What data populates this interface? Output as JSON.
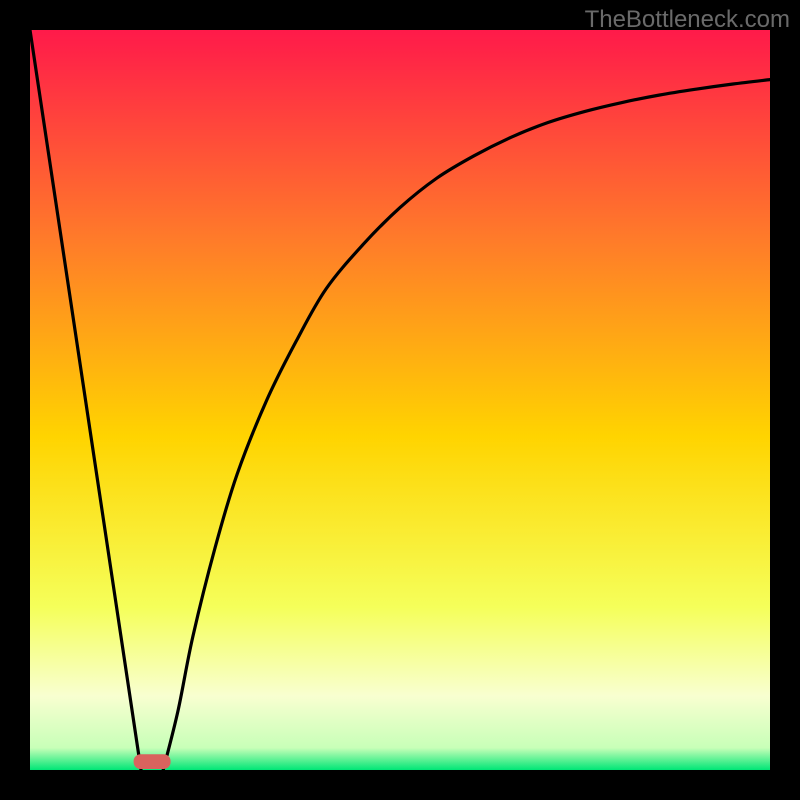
{
  "watermark": "TheBottleneck.com",
  "chart_data": {
    "type": "line",
    "title": "",
    "xlabel": "",
    "ylabel": "",
    "xlim": [
      0,
      100
    ],
    "ylim": [
      0,
      100
    ],
    "grid": false,
    "gradient_colors": {
      "top": "#ff1a4a",
      "upper_mid": "#ff7a2a",
      "mid": "#ffd400",
      "lower_mid": "#f5ff5a",
      "band": "#f8ffd0",
      "bottom": "#00e676"
    },
    "series": [
      {
        "name": "left-descending-line",
        "x": [
          0,
          15
        ],
        "y": [
          100,
          0
        ]
      },
      {
        "name": "right-ascending-curve",
        "x": [
          18,
          20,
          22,
          25,
          28,
          32,
          36,
          40,
          45,
          50,
          55,
          60,
          65,
          70,
          75,
          80,
          85,
          90,
          95,
          100
        ],
        "y": [
          0,
          8,
          18,
          30,
          40,
          50,
          58,
          65,
          71,
          76,
          80,
          83,
          85.5,
          87.5,
          89,
          90.2,
          91.2,
          92,
          92.7,
          93.3
        ]
      }
    ],
    "marker": {
      "name": "bottom-pill-marker",
      "x": 16.5,
      "y": 0,
      "color": "#d9635e",
      "width": 5,
      "height": 2
    }
  }
}
